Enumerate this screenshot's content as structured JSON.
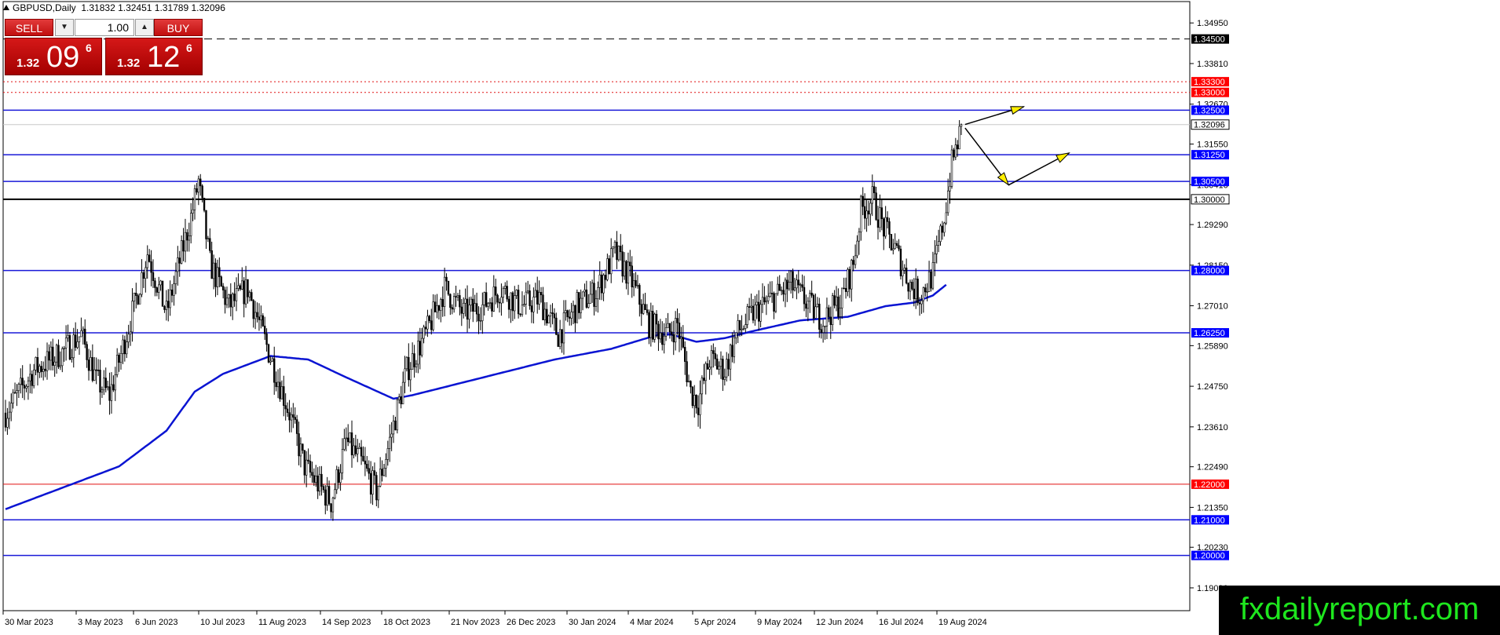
{
  "header": {
    "symbol": "GBPUSD,Daily",
    "ohlc": "1.31832 1.32451 1.31789 1.32096"
  },
  "trade_panel": {
    "sell_label": "SELL",
    "buy_label": "BUY",
    "lot_value": "1.00",
    "sell_price_small": "1.32",
    "sell_price_big": "09",
    "sell_price_sup": "6",
    "buy_price_small": "1.32",
    "buy_price_big": "12",
    "buy_price_sup": "6"
  },
  "watermark": "fxdailyreport.com",
  "colors": {
    "candle": "#000000",
    "ma": "#0a14d2",
    "support_blue": "#1a1ad8",
    "red_line": "#e01010",
    "label_blue_bg": "#0000ff",
    "label_red_bg": "#ff0000"
  },
  "chart_data": {
    "type": "candlestick",
    "symbol": "GBPUSD",
    "timeframe": "Daily",
    "ylim": [
      1.1845,
      1.3555
    ],
    "y_ticks": [
      "1.34950",
      "1.33810",
      "1.32670",
      "1.31550",
      "1.30410",
      "1.29290",
      "1.28150",
      "1.27010",
      "1.25890",
      "1.24750",
      "1.23610",
      "1.22490",
      "1.21350",
      "1.20230",
      "1.19090"
    ],
    "x_ticks": [
      "30 Mar 2023",
      "3 May 2023",
      "6 Jun 2023",
      "10 Jul 2023",
      "11 Aug 2023",
      "14 Sep 2023",
      "18 Oct 2023",
      "21 Nov 2023",
      "26 Dec 2023",
      "30 Jan 2024",
      "4 Mar 2024",
      "5 Apr 2024",
      "9 May 2024",
      "12 Jun 2024",
      "16 Jul 2024",
      "19 Aug 2024"
    ],
    "price_path": [
      [
        0,
        1.24
      ],
      [
        15,
        1.252
      ],
      [
        30,
        1.257
      ],
      [
        40,
        1.262
      ],
      [
        48,
        1.249
      ],
      [
        55,
        1.245
      ],
      [
        68,
        1.27
      ],
      [
        75,
        1.285
      ],
      [
        85,
        1.268
      ],
      [
        98,
        1.295
      ],
      [
        102,
        1.305
      ],
      [
        108,
        1.282
      ],
      [
        118,
        1.27
      ],
      [
        128,
        1.275
      ],
      [
        136,
        1.262
      ],
      [
        150,
        1.24
      ],
      [
        158,
        1.225
      ],
      [
        165,
        1.22
      ],
      [
        172,
        1.215
      ],
      [
        180,
        1.232
      ],
      [
        188,
        1.226
      ],
      [
        196,
        1.218
      ],
      [
        202,
        1.23
      ],
      [
        212,
        1.252
      ],
      [
        222,
        1.262
      ],
      [
        232,
        1.275
      ],
      [
        242,
        1.268
      ],
      [
        252,
        1.27
      ],
      [
        262,
        1.275
      ],
      [
        272,
        1.27
      ],
      [
        282,
        1.272
      ],
      [
        292,
        1.262
      ],
      [
        302,
        1.27
      ],
      [
        312,
        1.274
      ],
      [
        322,
        1.285
      ],
      [
        330,
        1.278
      ],
      [
        340,
        1.265
      ],
      [
        350,
        1.262
      ],
      [
        355,
        1.265
      ],
      [
        362,
        1.246
      ],
      [
        366,
        1.243
      ],
      [
        372,
        1.255
      ],
      [
        380,
        1.252
      ],
      [
        386,
        1.262
      ],
      [
        395,
        1.268
      ],
      [
        405,
        1.272
      ],
      [
        415,
        1.276
      ],
      [
        425,
        1.27
      ],
      [
        432,
        1.266
      ],
      [
        442,
        1.272
      ],
      [
        448,
        1.282
      ],
      [
        452,
        1.297
      ],
      [
        458,
        1.3
      ],
      [
        464,
        1.292
      ],
      [
        470,
        1.286
      ],
      [
        478,
        1.276
      ],
      [
        483,
        1.273
      ],
      [
        490,
        1.279
      ],
      [
        496,
        1.295
      ],
      [
        500,
        1.31
      ],
      [
        505,
        1.32
      ]
    ],
    "candle_count": 506,
    "moving_average": [
      [
        0,
        1.213
      ],
      [
        40,
        1.221
      ],
      [
        60,
        1.225
      ],
      [
        85,
        1.235
      ],
      [
        100,
        1.246
      ],
      [
        115,
        1.251
      ],
      [
        140,
        1.256
      ],
      [
        160,
        1.255
      ],
      [
        180,
        1.25
      ],
      [
        205,
        1.244
      ],
      [
        215,
        1.245
      ],
      [
        260,
        1.251
      ],
      [
        290,
        1.255
      ],
      [
        320,
        1.258
      ],
      [
        345,
        1.262
      ],
      [
        352,
        1.262
      ],
      [
        365,
        1.26
      ],
      [
        380,
        1.261
      ],
      [
        395,
        1.263
      ],
      [
        420,
        1.266
      ],
      [
        445,
        1.267
      ],
      [
        465,
        1.27
      ],
      [
        480,
        1.271
      ],
      [
        490,
        1.273
      ],
      [
        497,
        1.276
      ]
    ],
    "horizontal_lines": [
      {
        "price": 1.345,
        "label": "1.34500",
        "style": "dashed-black"
      },
      {
        "price": 1.333,
        "label": "1.33300",
        "style": "dotted-red"
      },
      {
        "price": 1.33,
        "label": "1.33000",
        "style": "dotted-red"
      },
      {
        "price": 1.325,
        "label": "1.32500",
        "style": "solid-blue"
      },
      {
        "price": 1.32096,
        "label": "1.32096",
        "style": "current"
      },
      {
        "price": 1.3125,
        "label": "1.31250",
        "style": "solid-blue"
      },
      {
        "price": 1.305,
        "label": "1.30500",
        "style": "solid-blue"
      },
      {
        "price": 1.3,
        "label": "1.30000",
        "style": "solid-black"
      },
      {
        "price": 1.28,
        "label": "1.28000",
        "style": "solid-blue"
      },
      {
        "price": 1.2625,
        "label": "1.26250",
        "style": "solid-blue"
      },
      {
        "price": 1.22,
        "label": "1.22000",
        "style": "solid-red"
      },
      {
        "price": 1.21,
        "label": "1.21000",
        "style": "solid-blue"
      },
      {
        "price": 1.2,
        "label": "1.20000",
        "style": "solid-blue"
      }
    ],
    "arrows": [
      {
        "from": [
          507,
          1.321
        ],
        "to": [
          538,
          1.326
        ]
      },
      {
        "from": [
          507,
          1.32
        ],
        "to": [
          530,
          1.304
        ]
      },
      {
        "from": [
          530,
          1.304
        ],
        "to": [
          562,
          1.313
        ]
      }
    ]
  }
}
